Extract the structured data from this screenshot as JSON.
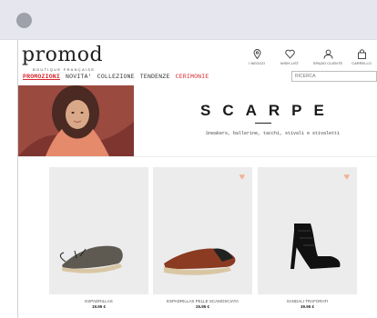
{
  "brand": {
    "logo": "promod",
    "tagline": "BOUTIQUE FRANÇAISE"
  },
  "toolbar": [
    {
      "label": "I NEGOZI",
      "icon": "location-pin-icon"
    },
    {
      "label": "WISH-LIST",
      "icon": "heart-icon"
    },
    {
      "label": "SPAZIO CLIENTE",
      "icon": "user-icon"
    },
    {
      "label": "CARRELLO",
      "icon": "shopping-bag-icon"
    }
  ],
  "nav": [
    {
      "label": "PROMOZIONI"
    },
    {
      "label": "NOVITA'"
    },
    {
      "label": "COLLEZIONE"
    },
    {
      "label": "TENDENZE"
    },
    {
      "label": "CERIMONIE"
    }
  ],
  "search": {
    "placeholder": "RICERCA"
  },
  "hero": {
    "title": "SCARPE",
    "subtitle": "Sneakers, ballerine, tacchi, stivali e stivaletti"
  },
  "products": [
    {
      "name": "ESPADRILLAS",
      "price": "19.95 €"
    },
    {
      "name": "ESPADRILLAS PELLE SCAMOSCIATA",
      "price": "25.95 €"
    },
    {
      "name": "SANDALI TRAFORATI",
      "price": "39.95 €"
    }
  ],
  "colors": {
    "accent": "#d8262c",
    "heart": "#f3b394",
    "browser_bar": "#e6e7ee"
  }
}
